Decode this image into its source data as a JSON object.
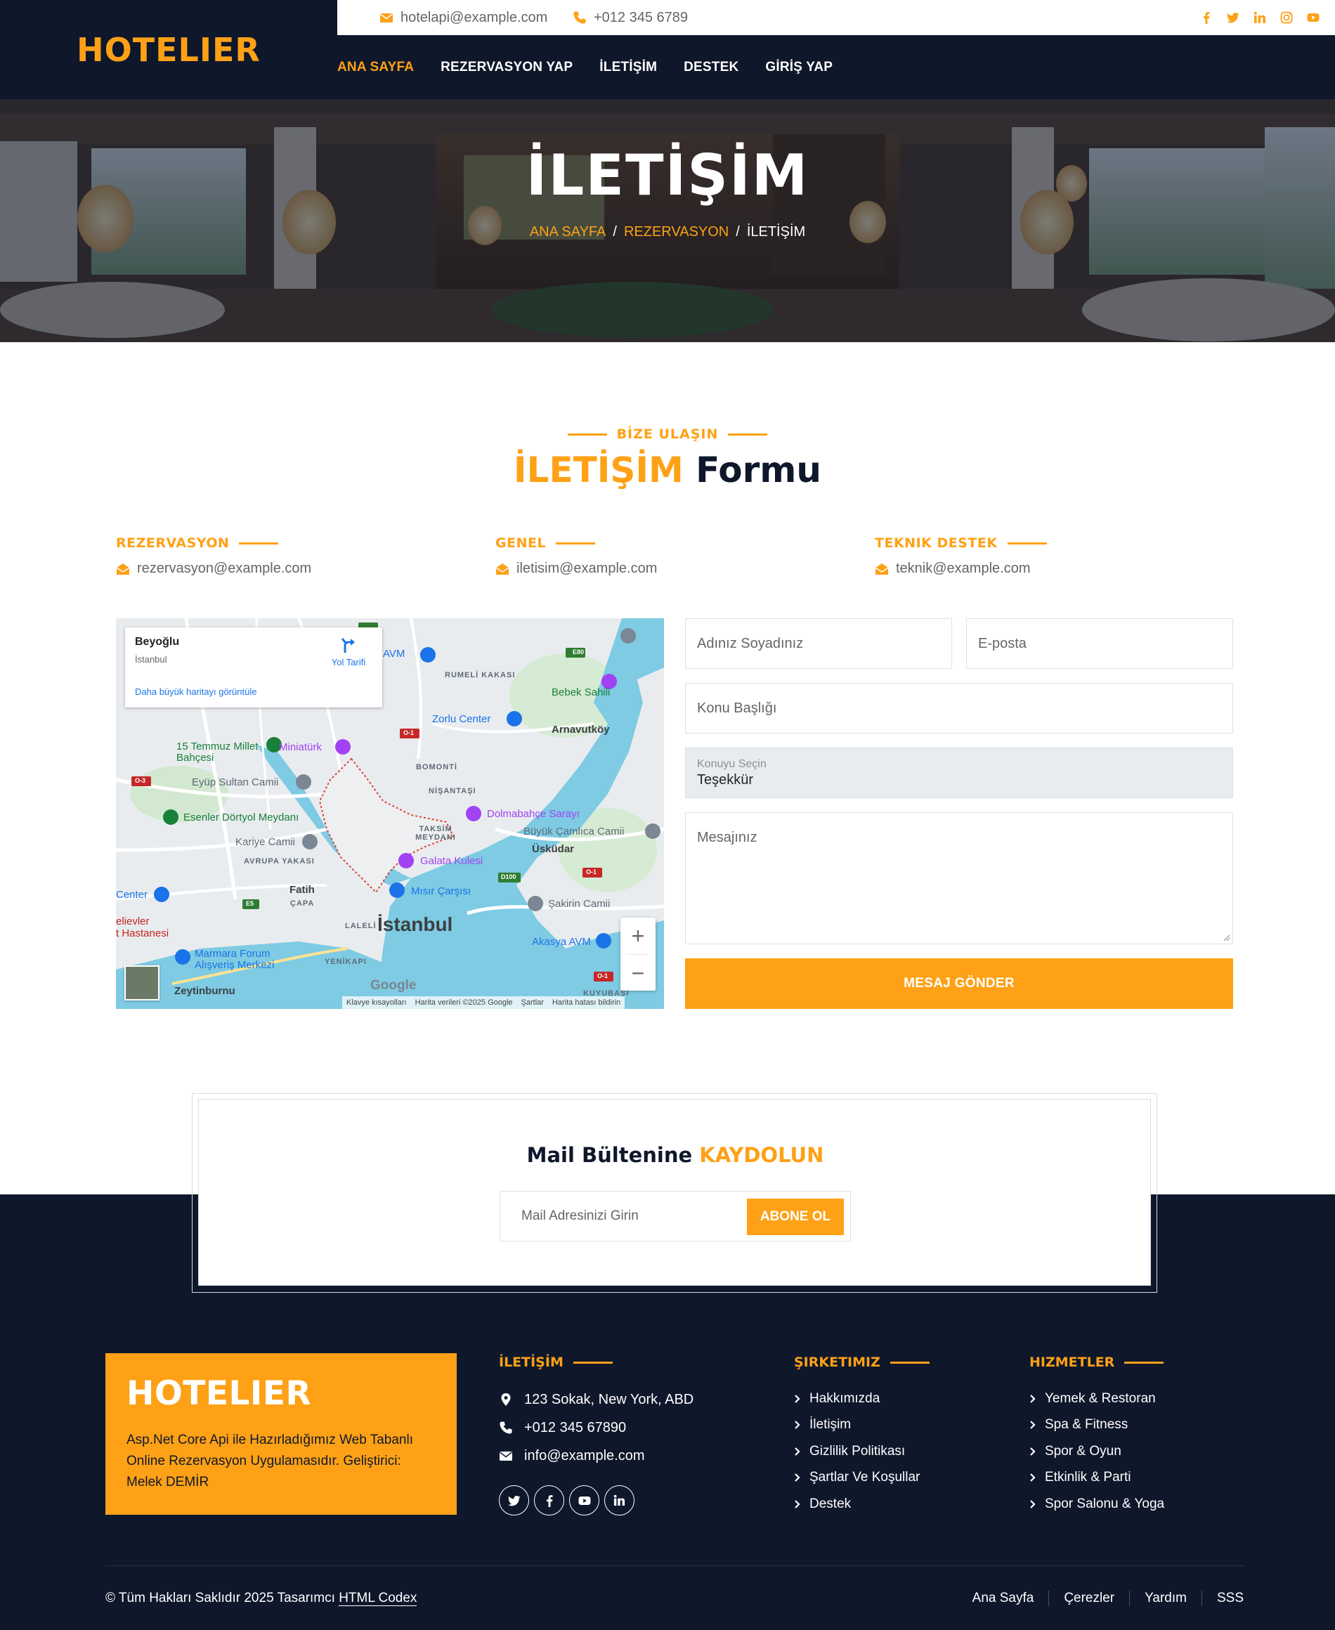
{
  "brand": {
    "logo": "HOTELIER"
  },
  "topbar": {
    "email": "hotelapi@example.com",
    "phone": "+012 345 6789",
    "socials": [
      "facebook-icon",
      "twitter-icon",
      "linkedin-icon",
      "instagram-icon",
      "youtube-icon"
    ]
  },
  "nav": {
    "items": [
      {
        "label": "ANA SAYFA",
        "active": true
      },
      {
        "label": "REZERVASYON YAP",
        "active": false
      },
      {
        "label": "İLETİŞİM",
        "active": false
      },
      {
        "label": "DESTEK",
        "active": false
      },
      {
        "label": "GİRİŞ YAP",
        "active": false
      }
    ]
  },
  "hero": {
    "title": "İLETİŞİM",
    "breadcrumb": [
      "ANA SAYFA",
      "REZERVASYON",
      "İLETİŞİM"
    ],
    "separator": "/"
  },
  "contact": {
    "subtitle": "BİZE ULAŞIN",
    "title_accent": "İLETİŞİM",
    "title_rest": "Formu",
    "columns": [
      {
        "label": "REZERVASYON",
        "email": "rezervasyon@example.com"
      },
      {
        "label": "GENEL",
        "email": "iletisim@example.com"
      },
      {
        "label": "TEKNIK DESTEK",
        "email": "teknik@example.com"
      }
    ]
  },
  "map": {
    "place": "Beyoğlu",
    "city": "İstanbul",
    "directions": "Yol Tarifi",
    "bigger_map": "Daha büyük haritayı görüntüle",
    "zoom_in": "+",
    "zoom_out": "−",
    "labels": {
      "istanbul": "İstanbul",
      "arnavutkoy": "Arnavutköy",
      "uskudar": "Üsküdar",
      "fatih": "Fatih",
      "zeytinburnu": "Zeytinburnu",
      "dolmabahce": "Dolmabahçe Sarayı",
      "galata": "Galata Kulesi",
      "misir": "Mısır Çarşısı",
      "zorlu": "Zorlu Center",
      "bebek": "Bebek Sahili",
      "miniaturk": "Miniatürk",
      "temmuz": "15 Temmuz Millet Bahçesi",
      "eyup": "Eyüp Sultan Camii",
      "esenler": "Esenler Dörtyol Meydanı",
      "kariye": "Kariye Camii",
      "buyukcamlica": "Büyük Çamlıca Camii",
      "sakirin": "Şakirin Camii",
      "akasya": "Akasya AVM",
      "marmara": "Marmara Forum Alışveriş Merkezi",
      "rumeli": "RUMELİ KAKASI",
      "bomonti": "BOMONTİ",
      "nisantasi": "NİŞANTAŞI",
      "taksim": "TAKSİM MEYDANI",
      "avrupa": "AVRUPA YAKASI",
      "capa": "ÇAPA",
      "laleli": "LALELİ",
      "yenikapi": "YENİKAPI",
      "kuyubasi": "KUYUBAŞI",
      "center": "Center",
      "avm": "AVM",
      "gulevler": "elievler",
      "hastanesi": "t Hastanesi",
      "e80": "E80",
      "e5": "E5",
      "d100": "D100",
      "o1a": "O-1",
      "o1b": "O-1",
      "o1c": "O-1",
      "o3": "O-3"
    },
    "google": "Google",
    "attribution": [
      "Klavye kısayolları",
      "Harita verileri ©2025 Google",
      "Şartlar",
      "Harita hatası bildirin"
    ]
  },
  "form": {
    "name_placeholder": "Adınız Soyadınız",
    "email_placeholder": "E-posta",
    "subject_placeholder": "Konu Başlığı",
    "select_label": "Konuyu Seçin",
    "select_value": "Teşekkür",
    "message_placeholder": "Mesajınız",
    "submit": "MESAJ GÖNDER"
  },
  "newsletter": {
    "title_rest": "Mail Bültenine",
    "title_accent": "KAYDOLUN",
    "placeholder": "Mail Adresinizi Girin",
    "button": "ABONE OL"
  },
  "footer": {
    "brand_title": "HOTELIER",
    "brand_desc": "Asp.Net Core Api ile Hazırladığımız Web Tabanlı Online Rezervasyon Uygulamasıdır. Geliştirici: Melek DEMİR",
    "contact_heading": "İLETİŞİM",
    "address": "123 Sokak, New York, ABD",
    "phone": "+012 345 67890",
    "email": "info@example.com",
    "company_heading": "ŞIRKETIMIZ",
    "company_links": [
      "Hakkımızda",
      "İletişim",
      "Gizlilik Politikası",
      "Şartlar Ve Koşullar",
      "Destek"
    ],
    "services_heading": "HIZMETLER",
    "services_links": [
      "Yemek & Restoran",
      "Spa & Fitness",
      "Spor & Oyun",
      "Etkinlik & Parti",
      "Spor Salonu & Yoga"
    ],
    "copyright_text": "© Tüm Hakları Saklıdır 2025 Tasarımcı",
    "copyright_link": "HTML Codex",
    "bottom_menu": [
      "Ana Sayfa",
      "Çerezler",
      "Yardım",
      "SSS"
    ]
  },
  "colors": {
    "accent": "#fea116",
    "navy": "#0f172b",
    "text": "#666565"
  }
}
